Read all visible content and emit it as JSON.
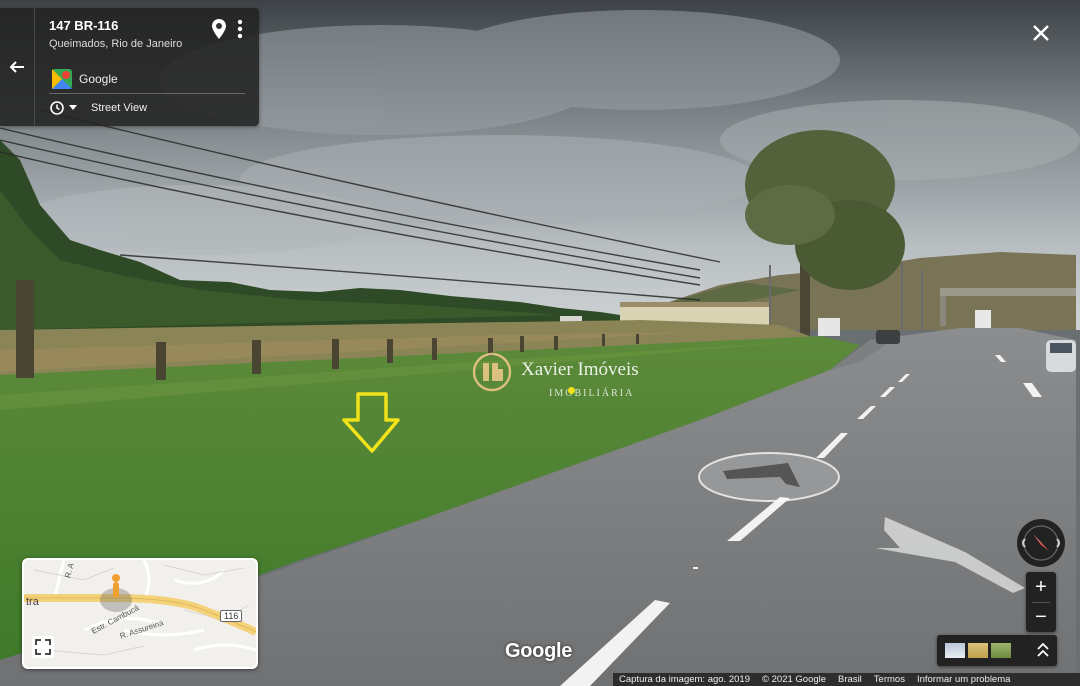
{
  "header": {
    "title": "147 BR-116",
    "subtitle": "Queimados, Rio de Janeiro",
    "brand_label": "Google",
    "mode_label": "Street View"
  },
  "icons": {
    "back": "arrow-left-icon",
    "pin": "location-pin-icon",
    "more": "more-vert-icon",
    "close": "close-icon",
    "history": "clock-history-icon",
    "expand": "fullscreen-icon",
    "compass": "compass-icon"
  },
  "watermark": {
    "name": "Xavier Imóveis",
    "subtitle": "IMOBILIÁRIA"
  },
  "minimap": {
    "labels": [
      "tra",
      "Estr. Cambucá",
      "R. Assureina",
      "116",
      "R. A"
    ]
  },
  "controls": {
    "zoom_in": "+",
    "zoom_out": "−"
  },
  "logo": "Google",
  "footer": {
    "capture": "Captura da imagem: ago. 2019",
    "copyright": "© 2021 Google",
    "country": "Brasil",
    "terms": "Termos",
    "report": "Informar um problema"
  },
  "colors": {
    "panel_bg": "#222222",
    "arrow_marker": "#f2e21a",
    "road_highlight": "#f3d27a"
  }
}
